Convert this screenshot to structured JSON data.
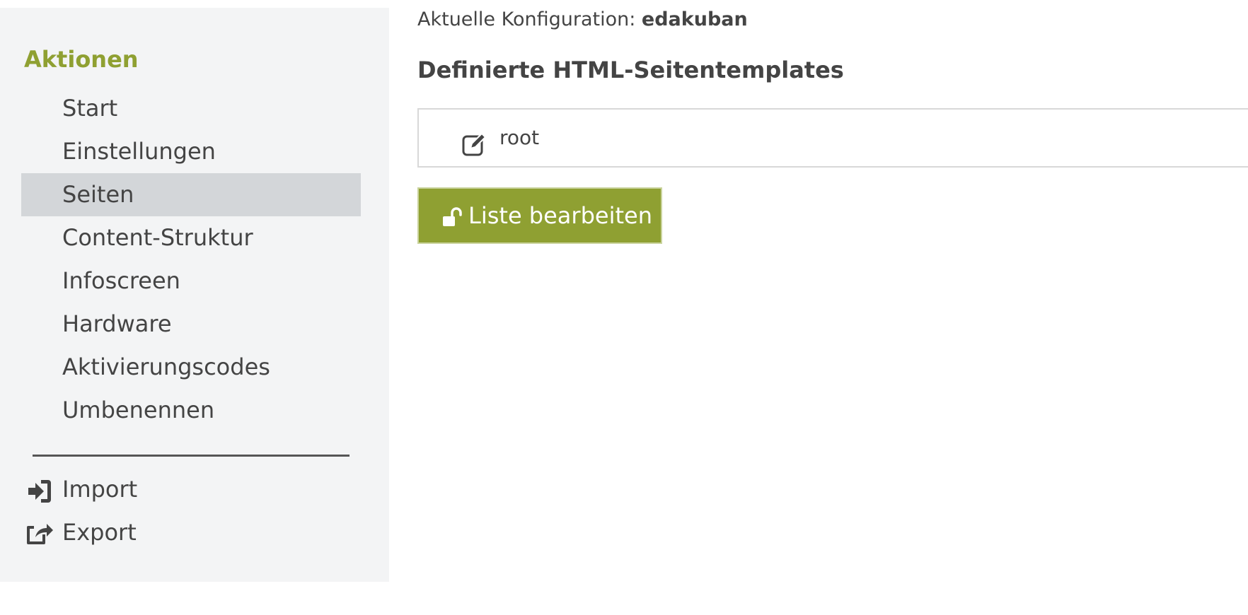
{
  "sidebar": {
    "heading": "Aktionen",
    "items": [
      {
        "label": "Start",
        "active": false
      },
      {
        "label": "Einstellungen",
        "active": false
      },
      {
        "label": "Seiten",
        "active": true
      },
      {
        "label": "Content-Struktur",
        "active": false
      },
      {
        "label": "Infoscreen",
        "active": false
      },
      {
        "label": "Hardware",
        "active": false
      },
      {
        "label": "Aktivierungscodes",
        "active": false
      },
      {
        "label": "Umbenennen",
        "active": false
      }
    ],
    "import": {
      "label": "Import",
      "icon": "sign-in-icon"
    },
    "export": {
      "label": "Export",
      "icon": "share-square-icon"
    }
  },
  "main": {
    "config_prefix": "Aktuelle Konfiguration:",
    "config_name": "edakuban",
    "section_title": "Definierte HTML-Seitentemplates",
    "templates": [
      {
        "label": "root",
        "icon": "edit-icon"
      }
    ],
    "edit_button": {
      "label": "Liste bearbeiten",
      "icon": "unlock-icon"
    }
  },
  "colors": {
    "accent": "#8fa032",
    "sidebar_bg": "#f3f4f5",
    "active_bg": "#d3d6d9",
    "text": "#444444"
  }
}
